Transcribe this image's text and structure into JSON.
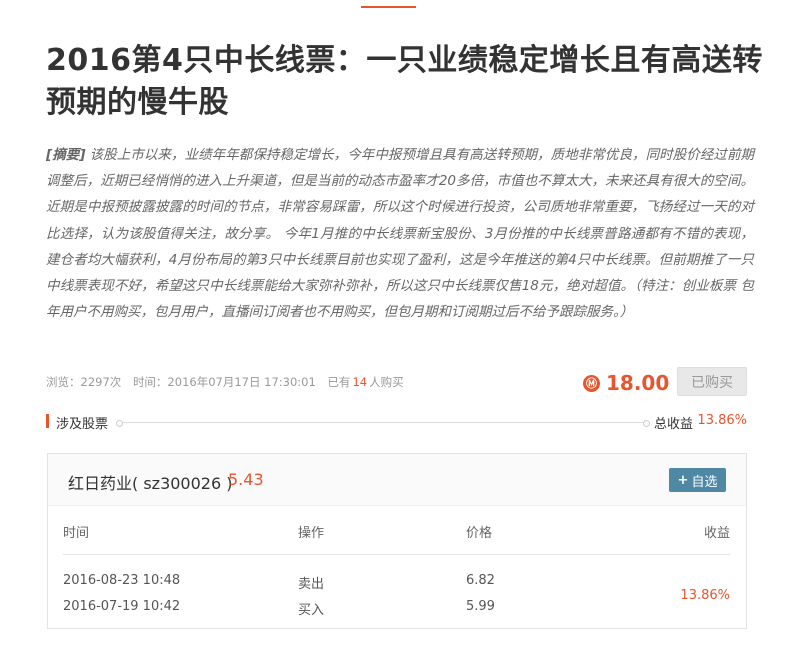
{
  "article": {
    "title": "2016第4只中长线票：一只业绩稳定增长且有高送转预期的慢牛股",
    "summary_tag": "[摘要]",
    "summary": "该股上市以来，业绩年年都保持稳定增长，今年中报预增且具有高送转预期，质地非常优良，同时股价经过前期调整后，近期已经悄悄的进入上升渠道，但是当前的动态市盈率才20多倍，市值也不算太大，未来还具有很大的空间。近期是中报预披露披露的时间的节点，非常容易踩雷，所以这个时候进行投资，公司质地非常重要，飞扬经过一天的对比选择，认为该股值得关注，故分享。 今年1月推的中长线票新宝股份、3月份推的中长线票普路通都有不错的表现，建仓者均大幅获利，4月份布局的第3只中长线票目前也实现了盈利，这是今年推送的第4只中长线票。但前期推了一只中线票表现不好，希望这只中长线票能给大家弥补弥补，所以这只中长线票仅售18元，绝对超值。（特注：创业板票 包年用户不用购买，包月用户，直播间订阅者也不用购买，但包月期和订阅期过后不给予跟踪服务。）"
  },
  "meta": {
    "views": "浏览：2297次",
    "time": "时间：2016年07月17日 17:30:01",
    "buyers_prefix": "已有",
    "buyers_count": "14",
    "buyers_suffix": "人购买"
  },
  "price": {
    "icon": "Ⓜ",
    "value": "18.00",
    "bought_label": "已购买"
  },
  "section": {
    "title": "涉及股票",
    "total_label": "总收益",
    "total_value": "13.86%"
  },
  "stock": {
    "name": "红日药业( sz300026 )",
    "price": "5.43",
    "add_label": "自选",
    "headers": {
      "time": "时间",
      "operation": "操作",
      "price": "价格",
      "profit": "收益"
    },
    "trades": [
      {
        "time": "2016-08-23 10:48",
        "operation": "卖出",
        "price": "6.82"
      },
      {
        "time": "2016-07-19 10:42",
        "operation": "买入",
        "price": "5.99"
      }
    ],
    "profit": "13.86%"
  },
  "colors": {
    "accent": "#e8552d",
    "button": "#4f88a5"
  }
}
